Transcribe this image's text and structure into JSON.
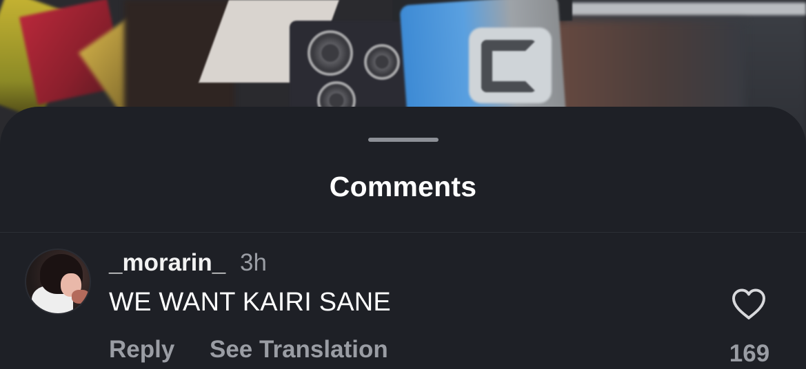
{
  "sheet": {
    "title": "Comments"
  },
  "comment": {
    "username": "_morarin_",
    "time": "3h",
    "text": "WE WANT KAIRI SANE",
    "reply_label": "Reply",
    "translate_label": "See Translation",
    "like_count": "169",
    "like_icon": "heart-outline-icon"
  },
  "colors": {
    "sheet_background": "#1e2026",
    "primary_text": "#ffffff",
    "secondary_text": "#9a9da4",
    "grabber": "#8d9097"
  }
}
